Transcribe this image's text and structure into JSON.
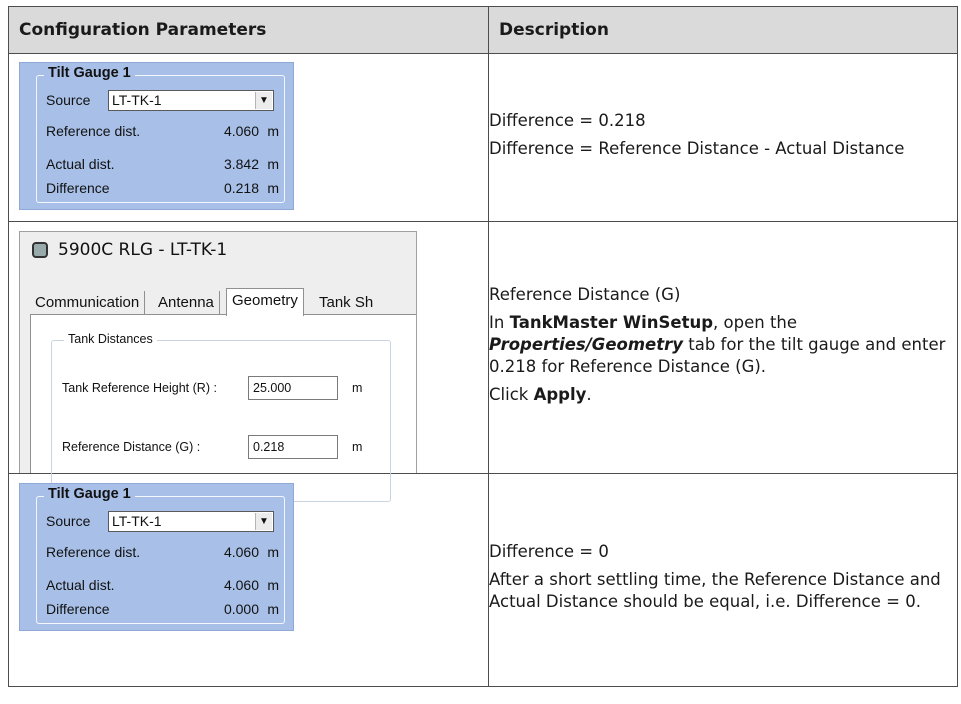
{
  "headers": {
    "col1": "Configuration Parameters",
    "col2": "Description"
  },
  "gauge_before": {
    "title": "Tilt Gauge 1",
    "source_label": "Source",
    "source_value": "LT-TK-1",
    "ref_label": "Reference dist.",
    "ref_value": "4.060",
    "ref_unit": "m",
    "act_label": "Actual dist.",
    "act_value": "3.842",
    "act_unit": "m",
    "diff_label": "Difference",
    "diff_value": "0.218",
    "diff_unit": "m"
  },
  "row1_desc": {
    "line1": "Difference = 0.218",
    "line2": "Difference = Reference Distance - Actual Distance"
  },
  "setup_window": {
    "title": "5900C RLG  - LT-TK-1",
    "tabs": [
      "Communication",
      "Antenna",
      "Geometry",
      "Tank Sh"
    ],
    "group_label": "Tank Distances",
    "trh_label": "Tank Reference Height (R) :",
    "trh_value": "25.000",
    "trh_unit": "m",
    "rd_label": "Reference Distance (G) :",
    "rd_value": "0.218",
    "rd_unit": "m"
  },
  "row2_desc": {
    "line1": "Reference Distance (G)",
    "p2_a": "In ",
    "p2_b": "TankMaster WinSetup",
    "p2_c": ", open the ",
    "p2_d": "Properties/Geometry",
    "p2_e": " tab for the tilt gauge and enter 0.218 for Reference Distance (G).",
    "p3_a": "Click ",
    "p3_b": "Apply",
    "p3_c": "."
  },
  "gauge_after": {
    "title": "Tilt Gauge 1",
    "source_label": "Source",
    "source_value": "LT-TK-1",
    "ref_label": "Reference dist.",
    "ref_value": "4.060",
    "ref_unit": "m",
    "act_label": "Actual dist.",
    "act_value": "4.060",
    "act_unit": "m",
    "diff_label": "Difference",
    "diff_value": "0.000",
    "diff_unit": "m"
  },
  "row3_desc": {
    "line1": "Difference = 0",
    "line2": "After a short settling time, the Reference Distance and Actual Distance should be equal, i.e. Difference = 0."
  }
}
